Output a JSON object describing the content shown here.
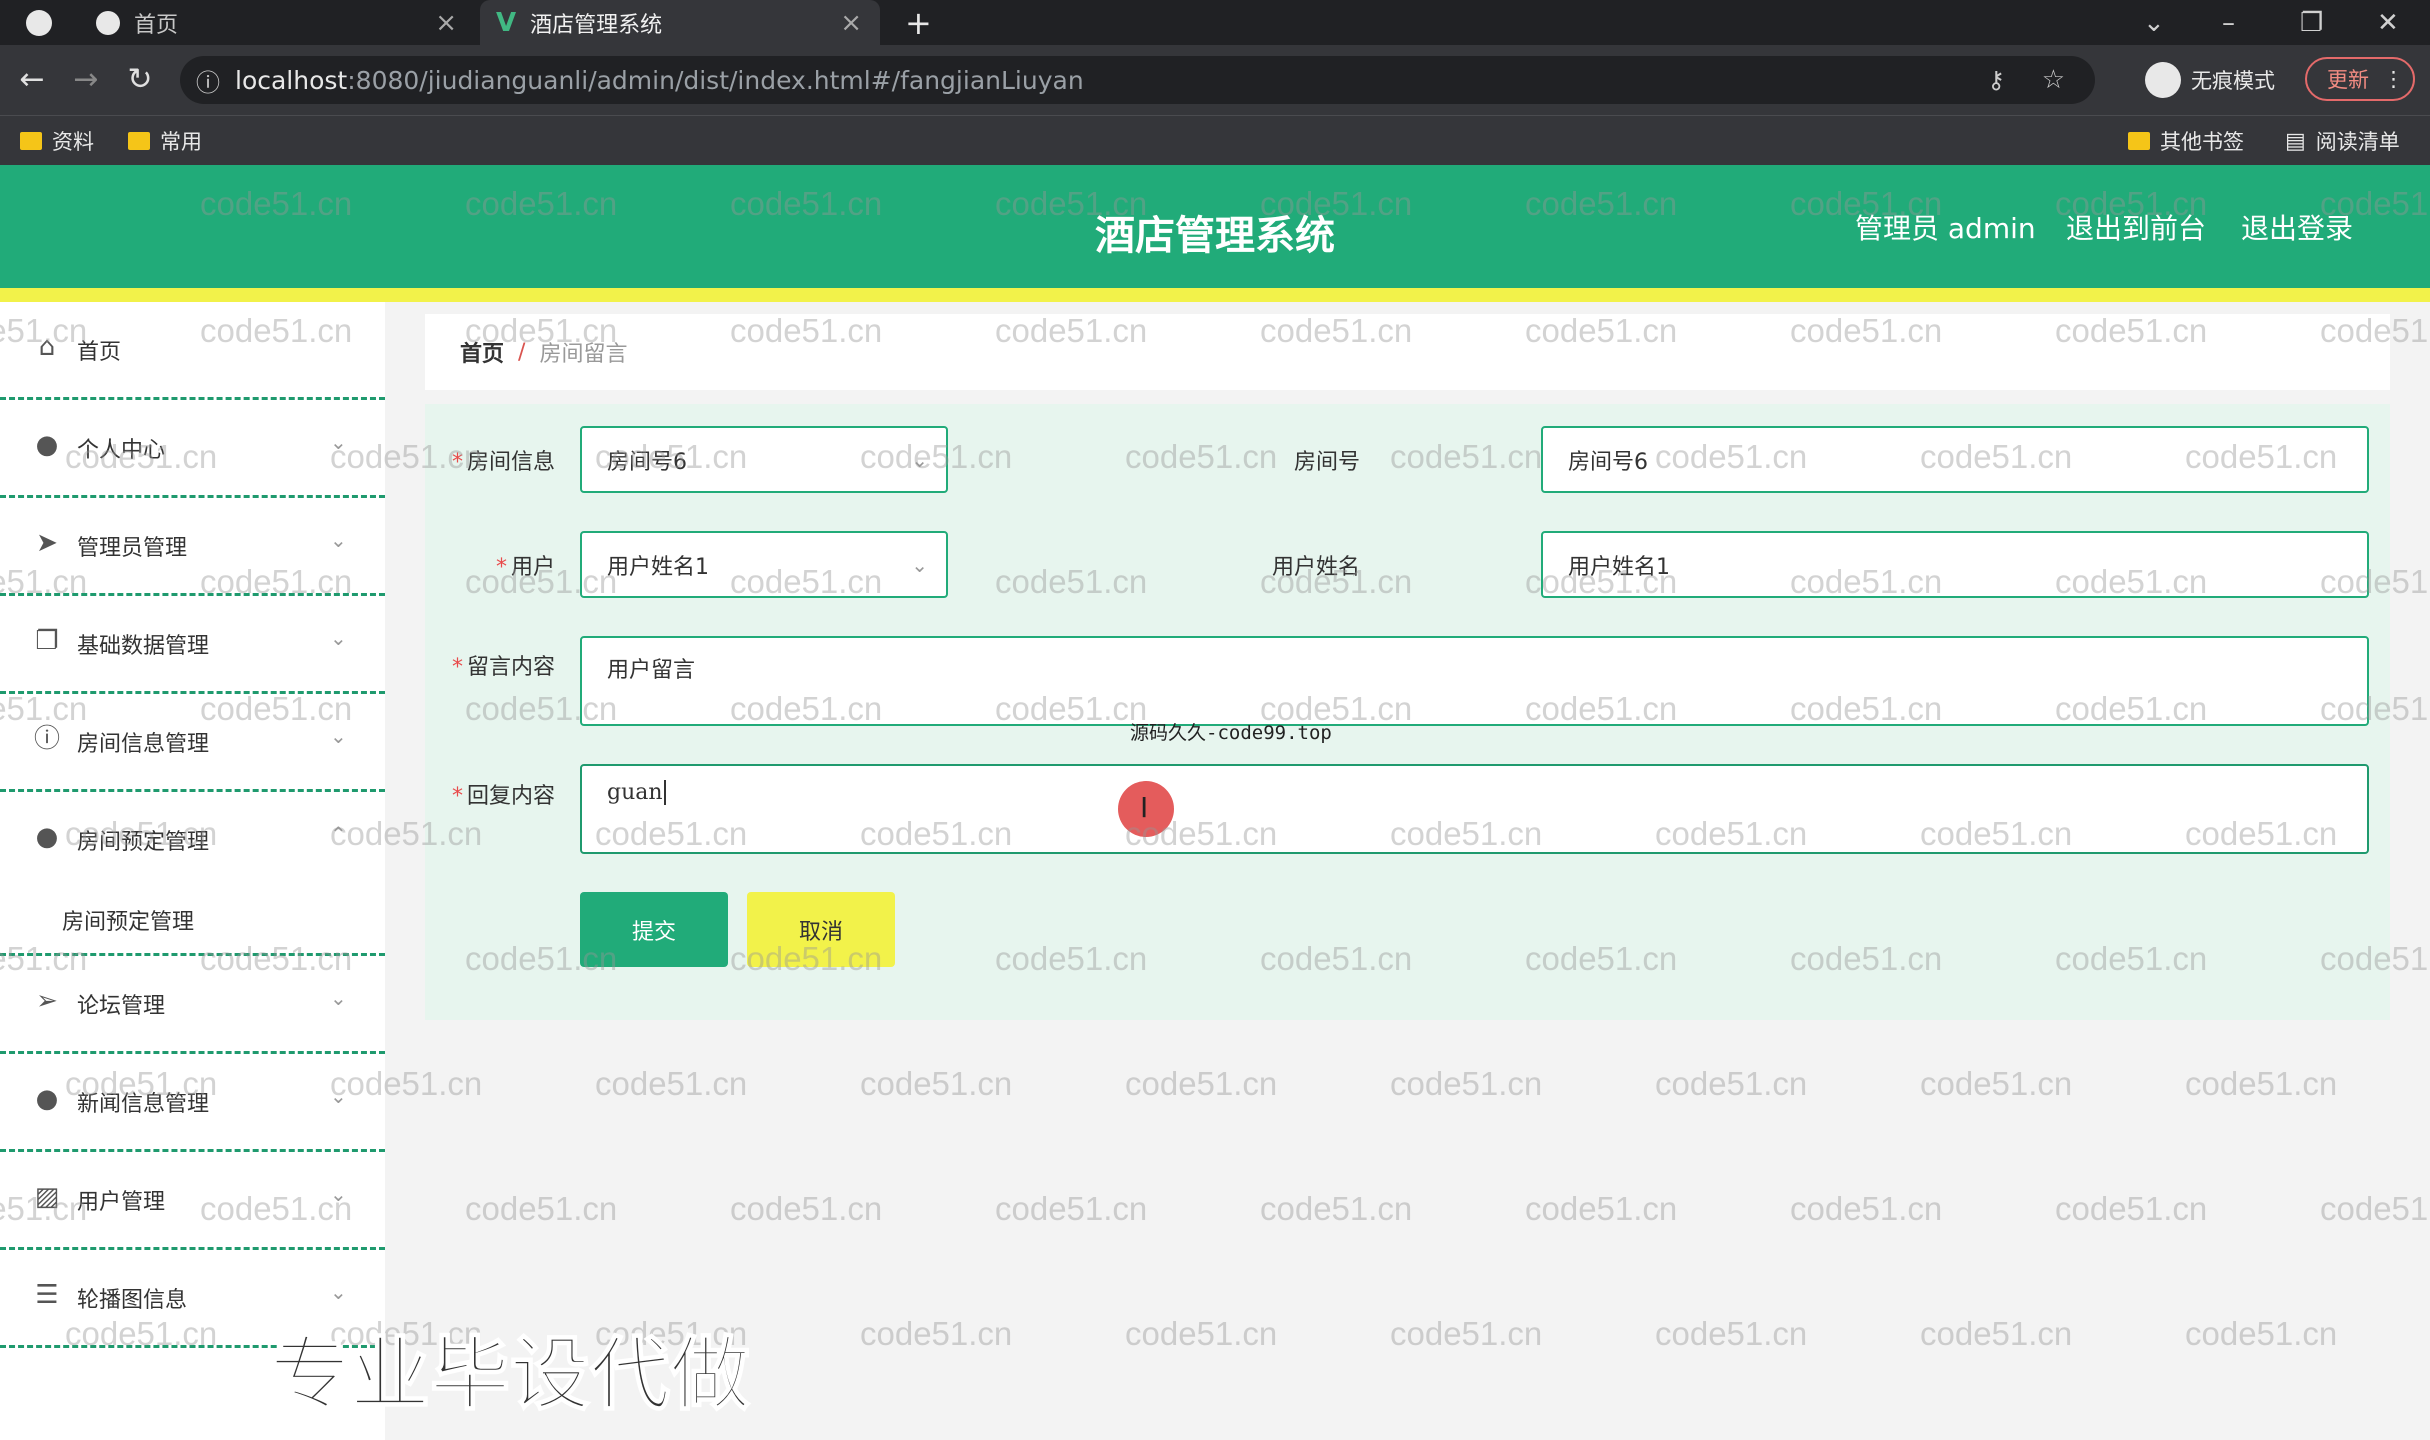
{
  "browser": {
    "tabs": [
      {
        "title": "首页"
      },
      {
        "title": "酒店管理系统"
      }
    ],
    "new_tab": "+",
    "url_host": "localhost",
    "url_rest": ":8080/jiudianguanli/admin/dist/index.html#/fangjianLiuyan",
    "incognito_label": "无痕模式",
    "update_label": "更新",
    "bookmarks": [
      "资料",
      "常用"
    ],
    "other_bookmarks": "其他书签",
    "reading_list": "阅读清单"
  },
  "header": {
    "title": "酒店管理系统",
    "user": "管理员 admin",
    "to_front": "退出到前台",
    "logout": "退出登录"
  },
  "sidebar": {
    "items": [
      {
        "label": "首页",
        "icon": "home-icon"
      },
      {
        "label": "个人中心",
        "icon": "user-icon"
      },
      {
        "label": "管理员管理",
        "icon": "send-icon"
      },
      {
        "label": "基础数据管理",
        "icon": "copy-icon"
      },
      {
        "label": "房间信息管理",
        "icon": "info-icon"
      },
      {
        "label": "房间预定管理",
        "icon": "pin-icon"
      },
      {
        "label": "论坛管理",
        "icon": "send-outline-icon"
      },
      {
        "label": "新闻信息管理",
        "icon": "user-icon"
      },
      {
        "label": "用户管理",
        "icon": "image-icon"
      },
      {
        "label": "轮播图信息",
        "icon": "menu-icon"
      }
    ],
    "sub_item": "房间预定管理"
  },
  "breadcrumb": {
    "home": "首页",
    "separator": "/",
    "current": "房间留言"
  },
  "form": {
    "room_info_label": "房间信息",
    "room_info_value": "房间号6",
    "room_no_label": "房间号",
    "room_no_value": "房间号6",
    "user_label": "用户",
    "user_value": "用户姓名1",
    "user_name_label": "用户姓名",
    "user_name_value": "用户姓名1",
    "message_label": "留言内容",
    "message_value": "用户留言",
    "reply_label": "回复内容",
    "reply_value": "guan",
    "submit": "提交",
    "cancel": "取消"
  },
  "watermark_text": "code51.cn",
  "overlay": {
    "big": "专业毕设代做",
    "small": "源码久久-code99.top"
  },
  "colors": {
    "brand": "#21ab79",
    "accent_yellow": "#f2f24a",
    "form_bg": "#e7f5ee"
  }
}
